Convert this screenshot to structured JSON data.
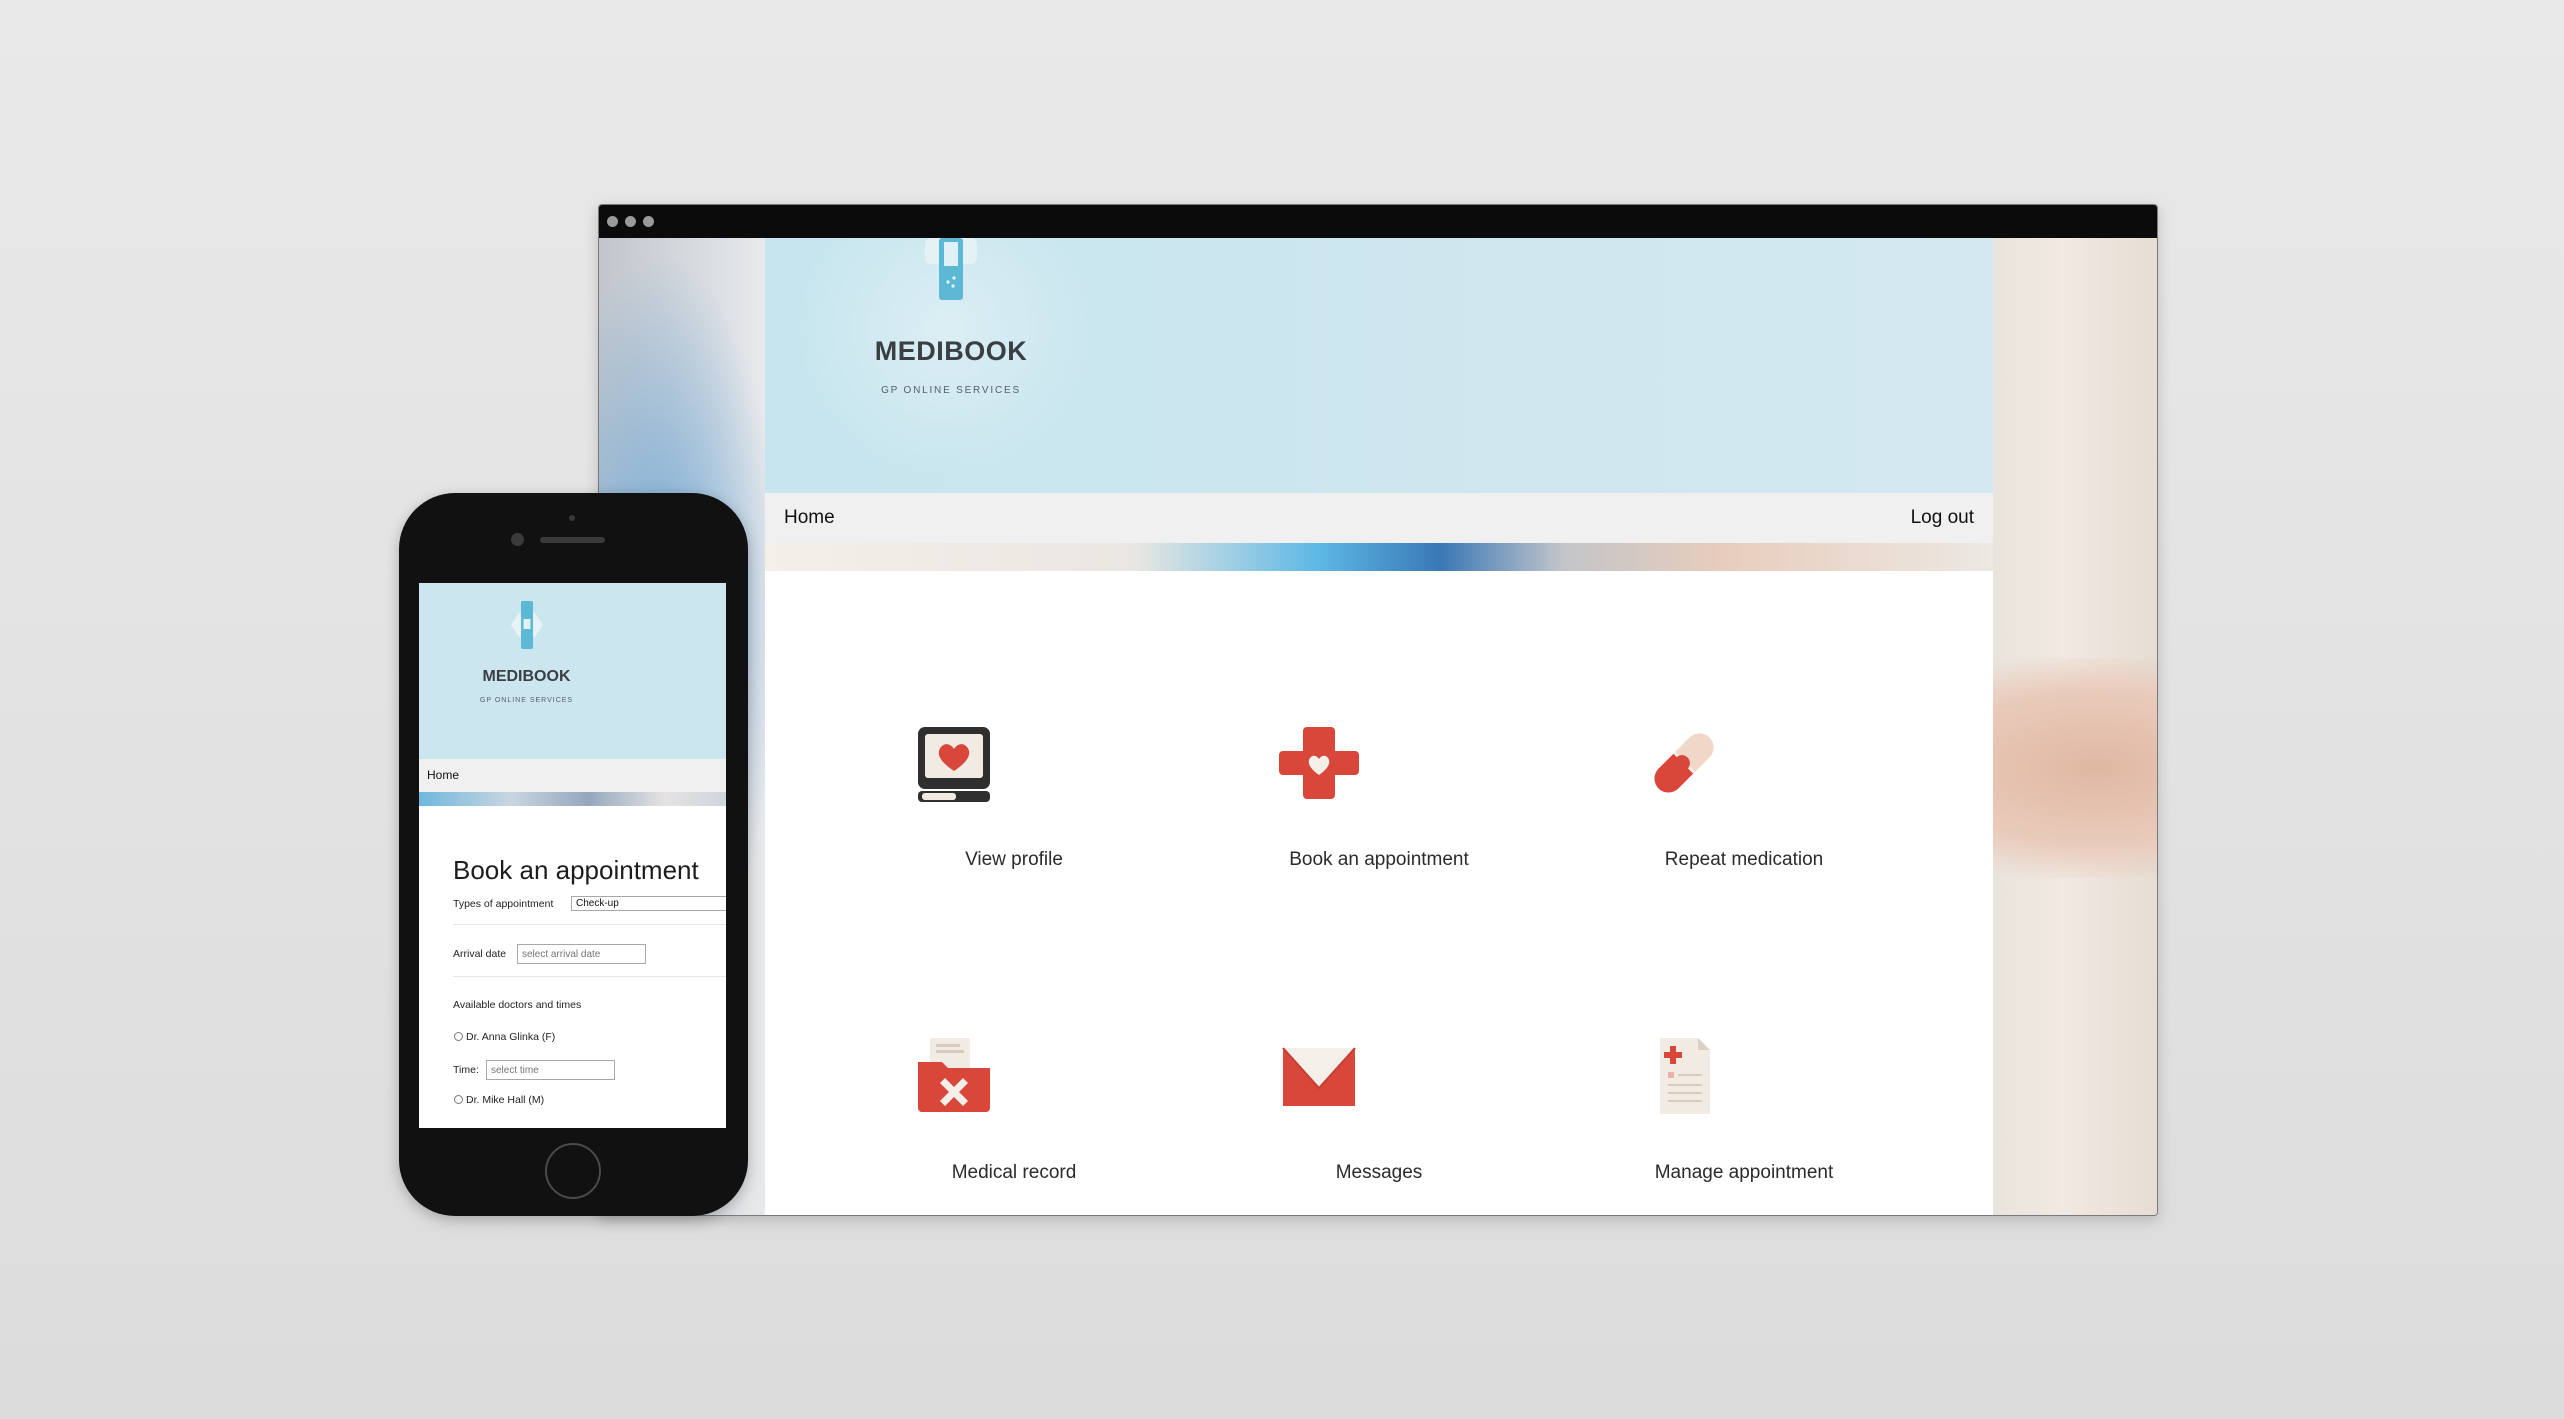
{
  "brand": {
    "name": "MEDIBOOK",
    "tagline": "GP ONLINE SERVICES"
  },
  "nav": {
    "home": "Home",
    "logout": "Log out"
  },
  "tiles": [
    {
      "label": "View profile",
      "icon": "profile-heart-icon"
    },
    {
      "label": "Book an appointment",
      "icon": "medical-cross-icon"
    },
    {
      "label": "Repeat medication",
      "icon": "pill-icon"
    },
    {
      "label": "Medical record",
      "icon": "folder-record-icon"
    },
    {
      "label": "Messages",
      "icon": "envelope-icon"
    },
    {
      "label": "Manage appointment",
      "icon": "document-icon"
    }
  ],
  "colors": {
    "accent": "#d9473a",
    "header_bg": "#c6e5ee",
    "navbar_bg": "#f0f0f0"
  },
  "mobile": {
    "nav_home": "Home",
    "title": "Book an appointment",
    "type_label": "Types of appointment",
    "type_value": "Check-up",
    "date_label": "Arrival date",
    "date_placeholder": "select arrival date",
    "doctors_heading": "Available doctors and times",
    "doctor_1": "Dr. Anna Glinka (F)",
    "time_label": "Time:",
    "time_placeholder": "select time",
    "doctor_2": "Dr. Mike Hall (M)"
  }
}
